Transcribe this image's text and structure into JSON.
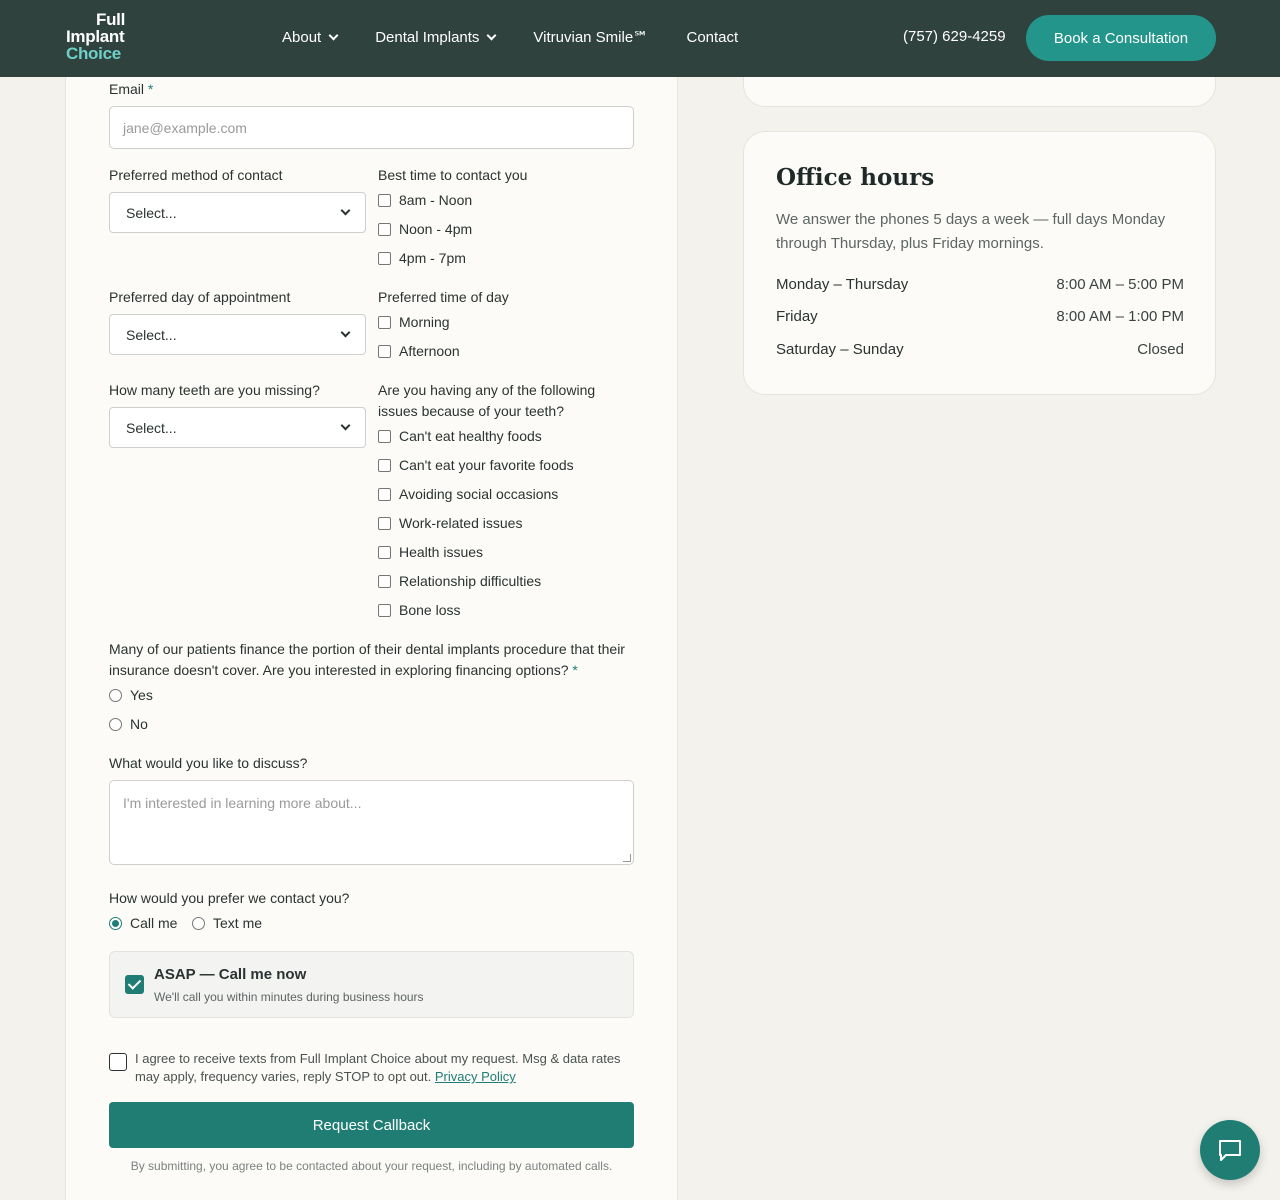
{
  "header": {
    "logo_line1": "Full",
    "logo_line2": "Implant",
    "logo_line3": "Choice",
    "nav": [
      {
        "label": "About"
      },
      {
        "label": "Dental Implants"
      },
      {
        "label": "Vitruvian Smile℠"
      },
      {
        "label": "Contact"
      }
    ],
    "phone": "(757) 629-4259",
    "cta_label": "Book a Consultation"
  },
  "form": {
    "email_label": "Email",
    "required_mark": "*",
    "email_placeholder": "jane@example.com",
    "contact_method_label": "Preferred method of contact",
    "contact_method_value": "Select...",
    "best_time_label": "Best time to contact you",
    "best_time_options": [
      "8am - Noon",
      "Noon - 4pm",
      "4pm - 7pm"
    ],
    "pref_day_label": "Preferred day of appointment",
    "pref_day_value": "Select...",
    "pref_time_label": "Preferred time of day",
    "pref_time_options": [
      "Morning",
      "Afternoon"
    ],
    "teeth_missing_label": "How many teeth are you missing?",
    "teeth_missing_value": "Select...",
    "issues_label": "Are you having any of the following issues because of your teeth?",
    "issues_options": [
      "Can't eat healthy foods",
      "Can't eat your favorite foods",
      "Avoiding social occasions",
      "Work-related issues",
      "Health issues",
      "Relationship difficulties",
      "Bone loss"
    ],
    "financing_label": "Many of our patients finance the portion of their dental implants procedure that their insurance doesn't cover. Are you interested in exploring financing options?",
    "financing_options": [
      "Yes",
      "No"
    ],
    "discuss_label": "What would you like to discuss?",
    "discuss_placeholder": "I'm interested in learning more about...",
    "prefer_contact_label": "How would you prefer we contact you?",
    "prefer_contact_options": [
      "Call me",
      "Text me"
    ],
    "prefer_contact_selected": "Call me",
    "asap_title": "ASAP — Call me now",
    "asap_sub": "We'll call you within minutes during business hours",
    "asap_checked": true,
    "consent_text": "I agree to receive texts from Full Implant Choice about my request. Msg & data rates may apply, frequency varies, reply STOP to opt out.",
    "consent_link": "Privacy Policy",
    "submit_label": "Request Callback",
    "disclaimer": "By submitting, you agree to be contacted about your request, including by automated calls."
  },
  "office_hours": {
    "title": "Office hours",
    "intro": "We answer the phones 5 days a week — full days Monday through Thursday, plus Friday mornings.",
    "rows": [
      {
        "days": "Monday – Thursday",
        "time": "8:00 AM – 5:00 PM"
      },
      {
        "days": "Friday",
        "time": "8:00 AM – 1:00 PM"
      },
      {
        "days": "Saturday – Sunday",
        "time": "Closed"
      }
    ]
  },
  "colors": {
    "header_bg": "#2f423e",
    "accent": "#1f7d73",
    "cta": "#24958a",
    "page_bg": "#f4f2ec"
  },
  "icons": {
    "chat": "chat-bubble-icon",
    "dropdown": "chevron-down-icon"
  }
}
